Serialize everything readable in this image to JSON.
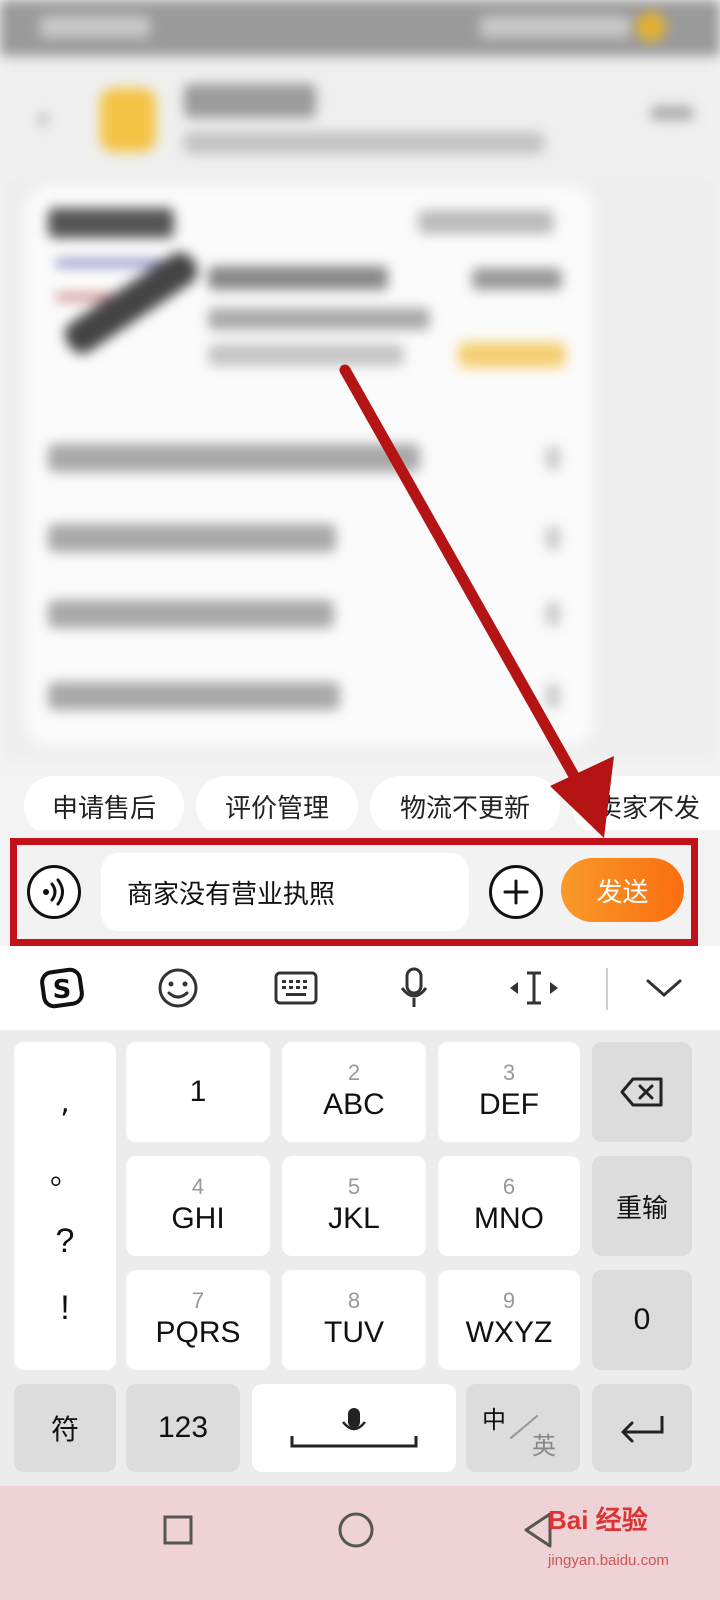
{
  "quick_replies": [
    "申请售后",
    "评价管理",
    "物流不更新",
    "卖家不发"
  ],
  "input": {
    "value": "商家没有营业执照",
    "send_label": "发送"
  },
  "keyboard": {
    "punct": [
      ",",
      "。",
      "?",
      "!"
    ],
    "keys": [
      {
        "num": "",
        "letters": "1"
      },
      {
        "num": "2",
        "letters": "ABC"
      },
      {
        "num": "3",
        "letters": "DEF"
      },
      {
        "num": "4",
        "letters": "GHI"
      },
      {
        "num": "5",
        "letters": "JKL"
      },
      {
        "num": "6",
        "letters": "MNO"
      },
      {
        "num": "7",
        "letters": "PQRS"
      },
      {
        "num": "8",
        "letters": "TUV"
      },
      {
        "num": "9",
        "letters": "WXYZ"
      }
    ],
    "reinput": "重输",
    "zero": "0",
    "symbol": "符",
    "num_mode": "123",
    "lang_cn": "中",
    "lang_en": "英"
  },
  "watermark": {
    "main": "Bai 经验",
    "sub": "jingyan.baidu.com"
  },
  "colors": {
    "send_gradient_start": "#f99a2a",
    "send_gradient_end": "#fb6d0f",
    "highlight": "#c3111a"
  }
}
